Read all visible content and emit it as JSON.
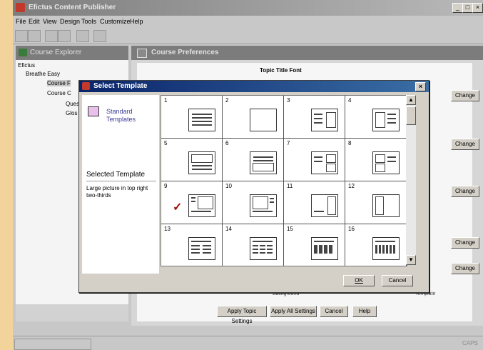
{
  "window": {
    "title": "Efictus Content Publisher",
    "controls": [
      "_",
      "□",
      "×"
    ]
  },
  "menu": [
    "File",
    "Edit",
    "View",
    "Design",
    "Tools",
    "Customize",
    "Help"
  ],
  "explorer": {
    "title": "Course Explorer",
    "tree": [
      "Efictus",
      "Breathe Easy",
      "Course F",
      "Course C",
      "Ques",
      "Glos"
    ]
  },
  "prefs": {
    "title": "Course Preferences",
    "section": "Topic Title Font",
    "change_label": "Change",
    "background_label": "Background",
    "template_label": "Template",
    "buttons": [
      "Apply Topic Settings",
      "Apply All Settings",
      "Cancel",
      "Help"
    ]
  },
  "dialog": {
    "title": "Select Template",
    "category": "Standard Templates",
    "selected_heading": "Selected Template",
    "selected_desc": "Large picture in top right two-thirds",
    "selected_index": 9,
    "templates": [
      "1",
      "2",
      "3",
      "4",
      "5",
      "6",
      "7",
      "8",
      "9",
      "10",
      "11",
      "12",
      "13",
      "14",
      "15",
      "16"
    ],
    "ok_label": "OK",
    "cancel_label": "Cancel"
  },
  "status": {
    "caps": "CAPS"
  }
}
